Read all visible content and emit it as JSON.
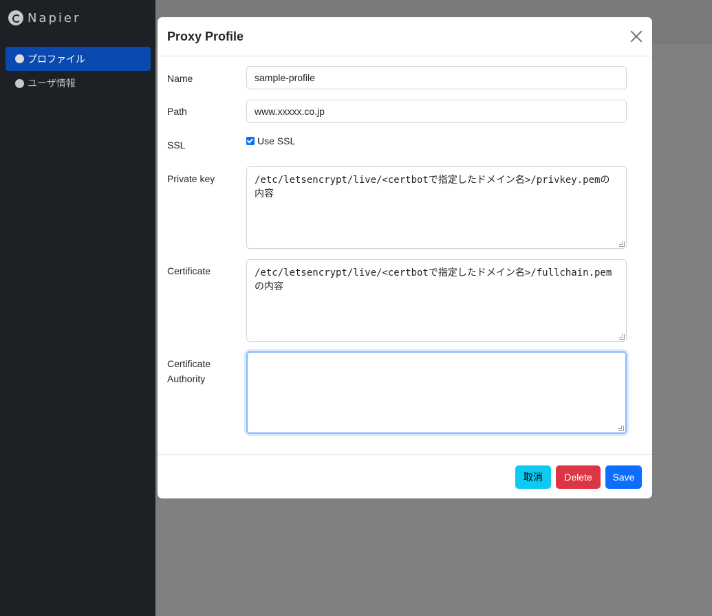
{
  "app": {
    "brand": "Napier"
  },
  "sidebar": {
    "items": [
      {
        "label": "プロファイル",
        "active": true
      },
      {
        "label": "ユーザ情報",
        "active": false
      }
    ]
  },
  "modal": {
    "title": "Proxy Profile",
    "fields": {
      "name": {
        "label": "Name",
        "value": "sample-profile"
      },
      "path": {
        "label": "Path",
        "value": "www.xxxxx.co.jp"
      },
      "ssl": {
        "label": "SSL",
        "checkbox_label": "Use SSL",
        "checked": true
      },
      "private_key": {
        "label": "Private key",
        "value": "/etc/letsencrypt/live/<certbotで指定したドメイン名>/privkey.pemの内容"
      },
      "certificate": {
        "label": "Certificate",
        "value": "/etc/letsencrypt/live/<certbotで指定したドメイン名>/fullchain.pemの内容"
      },
      "ca": {
        "label_line1": "Certificate",
        "label_line2": "Authority",
        "value": ""
      }
    },
    "buttons": {
      "cancel": "取消",
      "delete": "Delete",
      "save": "Save"
    }
  },
  "colors": {
    "sidebar_bg": "#1d2125",
    "active_nav": "#0a4ab0",
    "cancel": "#0dcaf0",
    "delete": "#dc3545",
    "save": "#0d6efd"
  }
}
